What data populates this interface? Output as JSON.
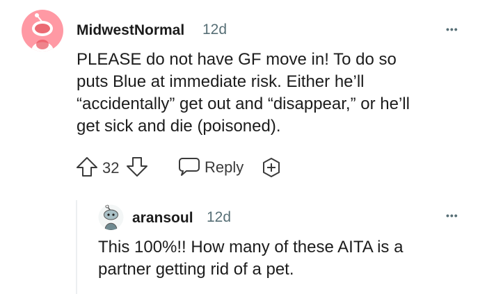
{
  "comment": {
    "username": "MidwestNormal",
    "timestamp": "12d",
    "more_label": "•••",
    "body": "PLEASE do not have GF move in! To do so\nputs Blue at immediate risk. Either he’ll\n“accidentally” get out and “disappear,” or he’ll\nget sick and die (poisoned).",
    "score": "32",
    "reply_label": "Reply",
    "avatar_color": "#ff99a4"
  },
  "reply": {
    "username": "aransoul",
    "timestamp": "12d",
    "more_label": "•••",
    "body": "This 100%!! How many of these AITA is a\npartner getting rid of a pet."
  },
  "icons": {
    "upvote": "arrow-up-icon",
    "downvote": "arrow-down-icon",
    "reply": "speech-bubble-icon",
    "award": "plus-circle-icon",
    "more": "ellipsis-icon"
  }
}
